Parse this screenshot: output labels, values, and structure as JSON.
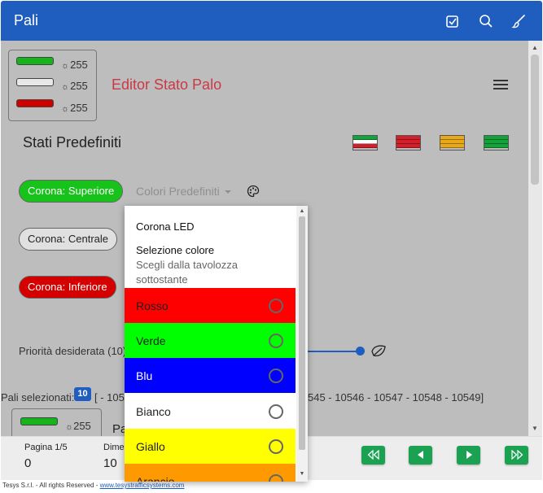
{
  "app": {
    "title": "Pali"
  },
  "toolbar": {
    "icons": [
      "checkbox-icon",
      "search-icon",
      "brush-icon"
    ]
  },
  "leds": [
    {
      "color": "#17b31b",
      "value": "255"
    },
    {
      "color": "#e8e8e8",
      "value": "255"
    },
    {
      "color": "#d00000",
      "value": "255"
    }
  ],
  "editor": {
    "title": "Editor Stato Palo"
  },
  "stati": {
    "title": "Stati Predefiniti",
    "presets": [
      {
        "stripes": [
          "#11a53b",
          "#ffffff",
          "#d21f2a"
        ]
      },
      {
        "stripes": [
          "#d21f2a",
          "#d21f2a",
          "#d21f2a"
        ]
      },
      {
        "stripes": [
          "#e8a817",
          "#e8a817",
          "#e8a817"
        ]
      },
      {
        "stripes": [
          "#13a23a",
          "#13a23a",
          "#13a23a"
        ]
      }
    ]
  },
  "corona": {
    "superiore": {
      "label": "Corona: Superiore",
      "color": "#17c21b"
    },
    "centrale": {
      "label": "Corona: Centrale",
      "color": "#e0e0e0"
    },
    "inferiore": {
      "label": "Corona: Inferiore",
      "color": "#d40000"
    }
  },
  "colori_predefiniti": {
    "label": "Colori Predefiniti"
  },
  "priorita": {
    "label": "Priorità desiderata (10)",
    "value": 10
  },
  "pali": {
    "label": "Pali selezionati:",
    "count": "10",
    "list_start": "[ - 105",
    "list_end": "545 - 10546 - 10547 - 10548 - 10549]"
  },
  "card": {
    "value": "255",
    "partial_text": "Pa"
  },
  "pagination": {
    "page_label": "Pagina 1/5",
    "page_value": "0",
    "dim_label": "Dime",
    "dim_value": "10"
  },
  "footer": {
    "text": "Tesys S.r.l. - All rights Reserved - ",
    "link": "www.tesystrafficsystems.com"
  },
  "dropdown": {
    "header": "Corona LED",
    "subtitle": "Selezione colore",
    "description": "Scegli dalla tavolozza sottostante",
    "options": [
      {
        "label": "Rosso",
        "color": "#ff0000",
        "text_color": "#222222"
      },
      {
        "label": "Verde",
        "color": "#00ff00",
        "text_color": "#222222"
      },
      {
        "label": "Blu",
        "color": "#0000ff",
        "text_color": "#ffffff"
      },
      {
        "label": "Bianco",
        "color": "#ffffff",
        "text_color": "#222222"
      },
      {
        "label": "Giallo",
        "color": "#ffff00",
        "text_color": "#222222"
      },
      {
        "label": "Arancio",
        "color": "#ff9900",
        "text_color": "#222222"
      }
    ]
  }
}
